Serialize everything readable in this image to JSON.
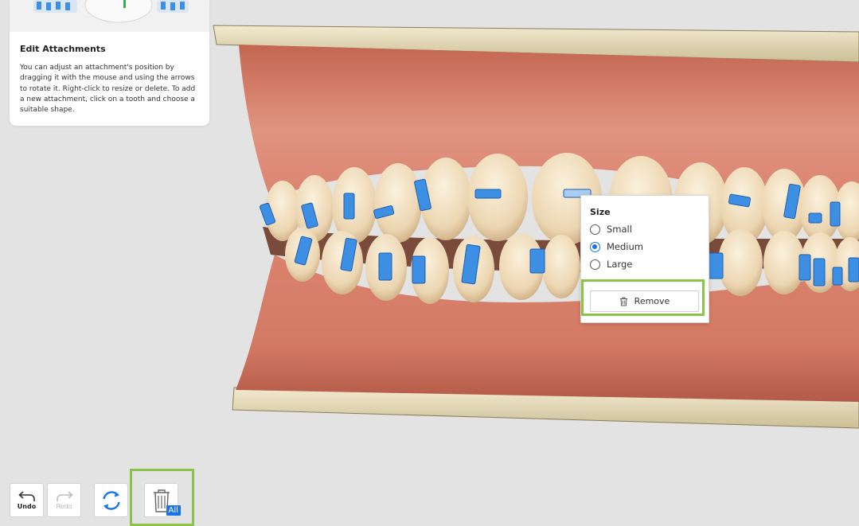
{
  "info_panel": {
    "title": "Edit Attachments",
    "body": "You can adjust an attachment's position by dragging it with the mouse and using the arrows to rotate it. Right-click to resize or delete. To add a new attachment, click on a tooth and choose a suitable shape."
  },
  "context_menu": {
    "heading": "Size",
    "options": [
      {
        "label": "Small",
        "selected": false
      },
      {
        "label": "Medium",
        "selected": true
      },
      {
        "label": "Large",
        "selected": false
      }
    ],
    "remove_label": "Remove"
  },
  "toolbar": {
    "undo_label": "Undo",
    "redo_label": "Redo",
    "redo_enabled": false,
    "delete_all_badge": "All"
  },
  "colors": {
    "accent": "#1a73e8",
    "highlight": "#8ac24a",
    "attachment": "#3d8fe3",
    "gum": "#d9806a",
    "tooth": "#efdcc0",
    "base": "#e9dfbe"
  },
  "icons": [
    "undo-icon",
    "redo-icon",
    "rotate-view-icon",
    "trash-icon",
    "delete-all-icon"
  ]
}
